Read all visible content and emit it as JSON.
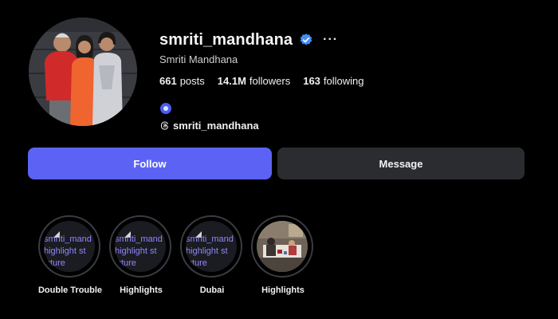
{
  "profile": {
    "username": "smriti_mandhana",
    "full_name": "Smriti Mandhana",
    "verified": true,
    "more_label": "···",
    "stats": [
      {
        "value": "661",
        "label": "posts"
      },
      {
        "value": "14.1M",
        "label": "followers"
      },
      {
        "value": "163",
        "label": "following"
      }
    ],
    "threads_handle": "smriti_mandhana"
  },
  "actions": {
    "follow_label": "Follow",
    "message_label": "Message"
  },
  "highlights": [
    {
      "title": "Double Trouble",
      "alt_lines": [
        "smriti_mand",
        "highlight st",
        "icture"
      ]
    },
    {
      "title": "Highlights",
      "alt_lines": [
        "smriti_mand",
        "highlight st",
        "icture"
      ]
    },
    {
      "title": "Dubai",
      "alt_lines": [
        "smriti_mand",
        "highlight st",
        "icture"
      ]
    },
    {
      "title": "Highlights",
      "alt_lines": []
    }
  ],
  "colors": {
    "background": "#000000",
    "follow_button": "#5c63f4",
    "message_button": "#2a2c30",
    "verified_badge": "#3f8ff7",
    "broken_image_text": "#8e87ff"
  }
}
